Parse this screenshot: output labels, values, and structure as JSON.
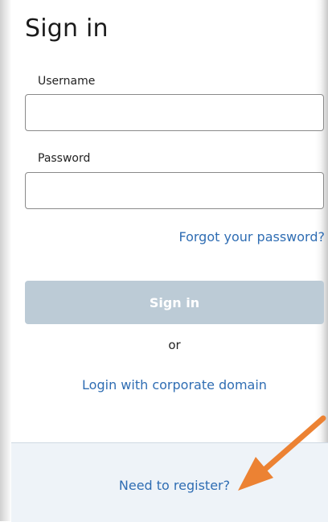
{
  "page": {
    "title": "Sign in"
  },
  "form": {
    "username_label": "Username",
    "username_value": "",
    "password_label": "Password",
    "password_value": "",
    "forgot_link": "Forgot your password?",
    "submit_label": "Sign in",
    "or_text": "or",
    "corporate_link": "Login with corporate domain"
  },
  "footer": {
    "register_link": "Need to register?"
  },
  "colors": {
    "link": "#2f6db3",
    "button_disabled": "#bccbd6",
    "footer_bg": "#eef3f8",
    "annotation_arrow": "#ec8233"
  },
  "annotation": {
    "icon": "arrow-pointer-icon"
  }
}
